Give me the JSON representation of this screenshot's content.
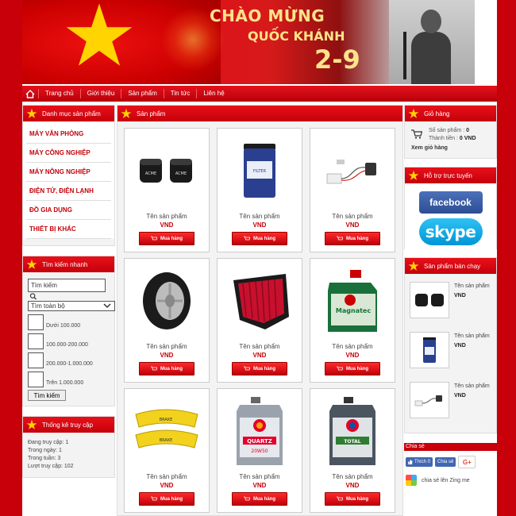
{
  "banner": {
    "line1": "CHÀO MỪNG",
    "line2": "QUỐC KHÁNH",
    "line3": "2-9"
  },
  "nav": {
    "items": [
      "Trang chủ",
      "Giới thiệu",
      "Sản phẩm",
      "Tin tức",
      "Liên hệ"
    ]
  },
  "categories": {
    "title": "Danh mục sản phẩm",
    "items": [
      "MÁY VĂN PHÒNG",
      "MÁY CÔNG NGHIỆP",
      "MÁY NÔNG NGHIỆP",
      "ĐIỆN TỬ, ĐIỆN LẠNH",
      "ĐỒ GIA DỤNG",
      "THIẾT BỊ KHÁC"
    ]
  },
  "search": {
    "title": "Tìm kiếm nhanh",
    "input_value": "Tìm kiếm",
    "select_value": "Tìm toàn bộ",
    "ranges": [
      "Dưới 100.000",
      "100.000-200.000",
      "200.000-1.000.000",
      "Trên 1.000.000"
    ],
    "button": "Tìm kiếm"
  },
  "stats": {
    "title": "Thống kê truy cập",
    "lines": [
      "Đang truy cập: 1",
      "Trong ngày: 1",
      "Trong tuần: 3",
      "Lượt truy cập: 102"
    ]
  },
  "products": {
    "title": "Sản phẩm",
    "items": [
      {
        "name": "Tên sản phẩm",
        "price": "VND",
        "button": "Mua hàng",
        "image": "valve-caps"
      },
      {
        "name": "Tên sản phẩm",
        "price": "VND",
        "button": "Mua hàng",
        "image": "oil-filter"
      },
      {
        "name": "Tên sản phẩm",
        "price": "VND",
        "button": "Mua hàng",
        "image": "sensor-wire"
      },
      {
        "name": "Tên sản phẩm",
        "price": "VND",
        "button": "Mua hàng",
        "image": "tire"
      },
      {
        "name": "Tên sản phẩm",
        "price": "VND",
        "button": "Mua hàng",
        "image": "air-filter"
      },
      {
        "name": "Tên sản phẩm",
        "price": "VND",
        "button": "Mua hàng",
        "image": "castrol-oil"
      },
      {
        "name": "Tên sản phẩm",
        "price": "VND",
        "button": "Mua hàng",
        "image": "brake-calipers"
      },
      {
        "name": "Tên sản phẩm",
        "price": "VND",
        "button": "Mua hàng",
        "image": "total-oil"
      },
      {
        "name": "Tên sản phẩm",
        "price": "VND",
        "button": "Mua hàng",
        "image": "total-oil-2"
      }
    ]
  },
  "cart": {
    "title": "Giỏ hàng",
    "count_label": "Số sản phẩm :",
    "count": "0",
    "total_label": "Thành tiền :",
    "total": "0 VND",
    "view": "Xem giỏ hàng"
  },
  "support": {
    "title": "Hỗ trợ trực tuyến",
    "facebook": "facebook",
    "skype": "skype"
  },
  "bestsellers": {
    "title": "Sản phẩm bán chạy",
    "items": [
      {
        "name": "Tên sản phẩm",
        "price": "VND"
      },
      {
        "name": "Tên sản phẩm",
        "price": "VND"
      },
      {
        "name": "Tên sản phẩm",
        "price": "VND"
      }
    ]
  },
  "share": {
    "title": "Chia sẻ",
    "like": "Thích 0",
    "share_btn": "Chia sẻ",
    "gplus": "G+",
    "zing": "chia sẻ lên Zing me"
  }
}
